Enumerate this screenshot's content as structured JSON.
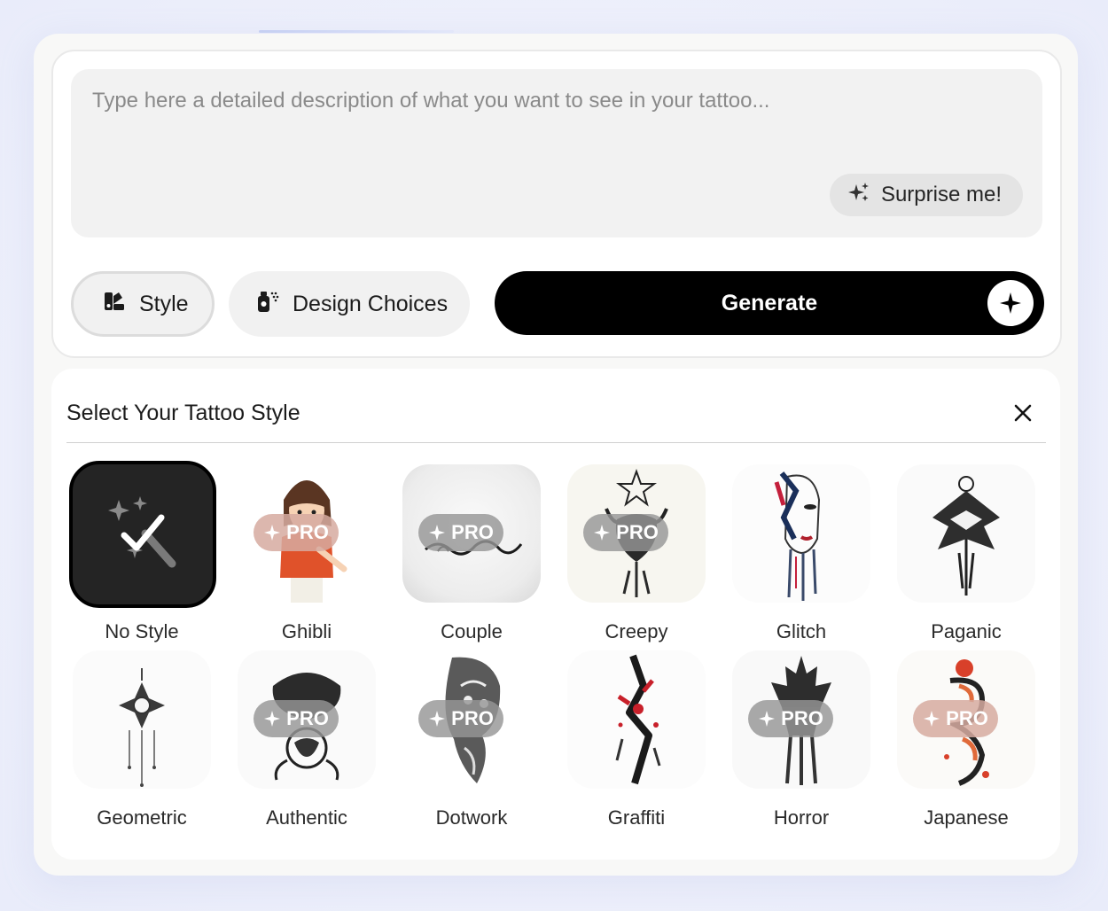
{
  "prompt": {
    "placeholder": "Type here a detailed description of what you want to see in your tattoo...",
    "value": "",
    "surprise_label": "Surprise me!"
  },
  "actions": {
    "style_label": "Style",
    "design_label": "Design Choices",
    "generate_label": "Generate"
  },
  "style_panel": {
    "title": "Select Your Tattoo Style",
    "pro_badge": "PRO",
    "styles": [
      {
        "label": "No Style",
        "pro": false,
        "selected": true,
        "icon": "magic-wand-icon"
      },
      {
        "label": "Ghibli",
        "pro": true
      },
      {
        "label": "Couple",
        "pro": true
      },
      {
        "label": "Creepy",
        "pro": true
      },
      {
        "label": "Glitch",
        "pro": false
      },
      {
        "label": "Paganic",
        "pro": false
      },
      {
        "label": "Geometric",
        "pro": false
      },
      {
        "label": "Authentic",
        "pro": true
      },
      {
        "label": "Dotwork",
        "pro": true
      },
      {
        "label": "Graffiti",
        "pro": false
      },
      {
        "label": "Horror",
        "pro": true
      },
      {
        "label": "Japanese",
        "pro": true
      }
    ]
  },
  "colors": {
    "accent": "#000000",
    "panel_bg": "#ffffff",
    "outer_bg": "#f8f8f7"
  }
}
